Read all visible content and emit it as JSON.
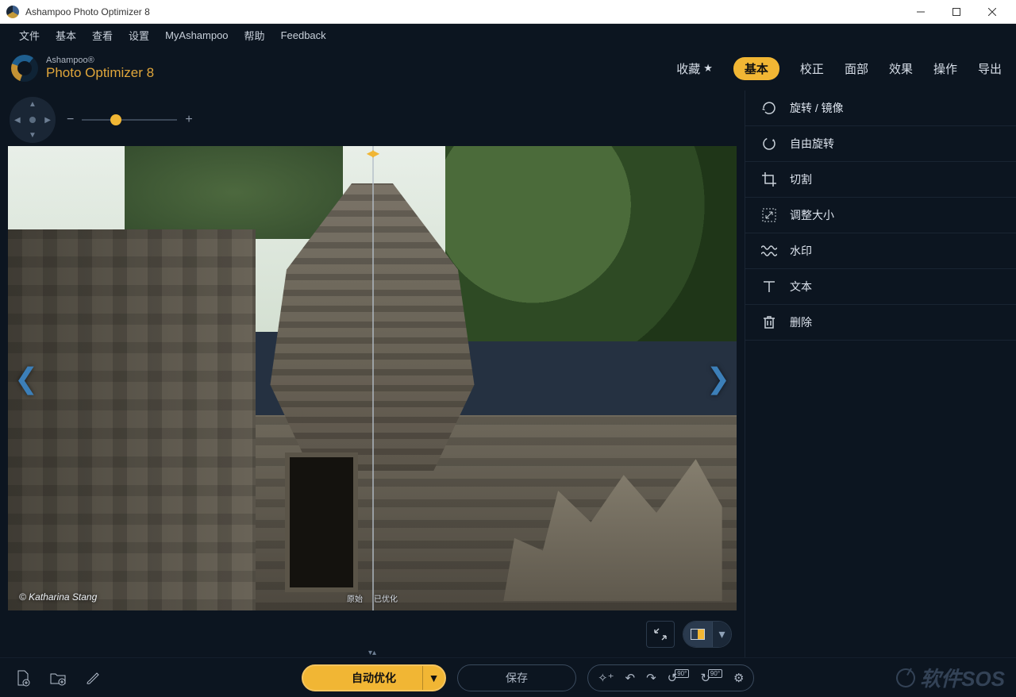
{
  "window": {
    "title": "Ashampoo Photo Optimizer 8"
  },
  "menu": [
    "文件",
    "基本",
    "查看",
    "设置",
    "MyAshampoo",
    "帮助",
    "Feedback"
  ],
  "brand": {
    "line1": "Ashampoo®",
    "line2": "Photo Optimizer 8"
  },
  "tabs": {
    "favorites": "收藏",
    "basic": "基本",
    "correction": "校正",
    "face": "面部",
    "effects": "效果",
    "operate": "操作",
    "export": "导出",
    "active": "basic"
  },
  "side_items": [
    {
      "icon": "rotate-mirror-icon",
      "label": "旋转 / 镜像"
    },
    {
      "icon": "free-rotate-icon",
      "label": "自由旋转"
    },
    {
      "icon": "crop-icon",
      "label": "切割"
    },
    {
      "icon": "resize-icon",
      "label": "调整大小"
    },
    {
      "icon": "watermark-icon",
      "label": "水印"
    },
    {
      "icon": "text-icon",
      "label": "文本"
    },
    {
      "icon": "delete-icon",
      "label": "删除"
    }
  ],
  "canvas": {
    "credit": "© Katharina Stang",
    "label_original": "原始",
    "label_optimized": "已优化"
  },
  "bottom": {
    "auto_optimize": "自动优化",
    "save": "保存"
  },
  "watermark_text": "软件SOS",
  "colors": {
    "accent": "#f1b634",
    "bg": "#0c1520"
  }
}
